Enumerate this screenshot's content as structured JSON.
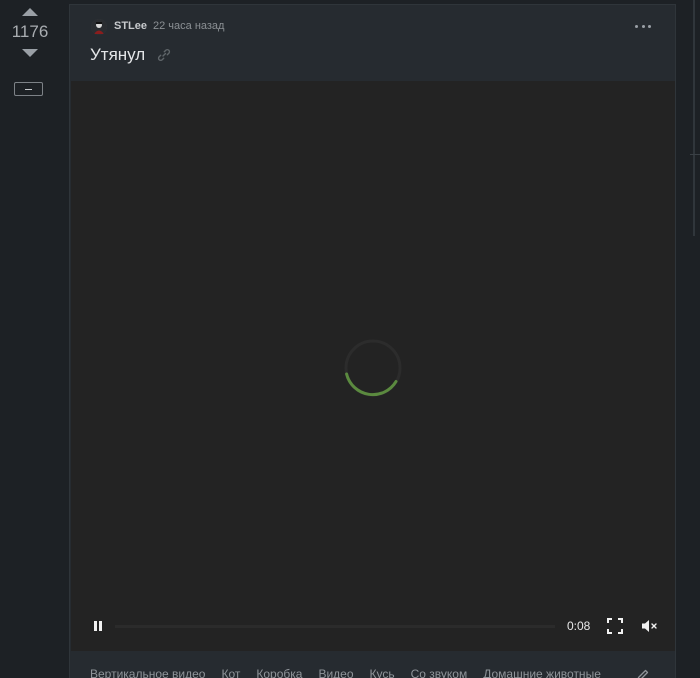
{
  "rating": {
    "count": "1176"
  },
  "post": {
    "author": "STLee",
    "time": "22 часа назад",
    "title": "Утянул"
  },
  "video": {
    "time": "0:08",
    "progress": 0.0,
    "state": "loading",
    "accent_color": "#5b8a3f"
  },
  "tags": [
    "Вертикальное видео",
    "Кот",
    "Коробка",
    "Видео",
    "Кусь",
    "Со звуком",
    "Домашние животные"
  ],
  "icons": {
    "upvote": "arrow-up-icon",
    "downvote": "arrow-down-icon",
    "collapse": "minus-icon",
    "menu": "more-dots-icon",
    "link": "link-icon",
    "pause": "pause-icon",
    "fullscreen": "fullscreen-icon",
    "mute": "volume-muted-icon",
    "edit": "pencil-icon"
  }
}
